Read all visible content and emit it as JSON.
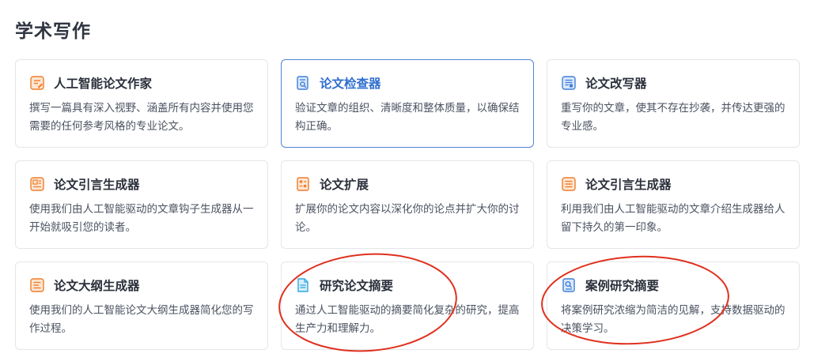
{
  "section": {
    "title": "学术写作"
  },
  "cards": [
    {
      "title": "人工智能论文作家",
      "desc": "撰写一篇具有深入视野、涵盖所有内容并使用您需要的任何参考风格的专业论文。",
      "icon": "pen-on-paper-icon",
      "color": "#f07d2a"
    },
    {
      "title": "论文检查器",
      "desc": "验证文章的组织、清晰度和整体质量，以确保结构正确。",
      "icon": "document-search-icon",
      "color": "#3f7fd8"
    },
    {
      "title": "论文改写器",
      "desc": "重写你的文章，使其不存在抄袭，并传达更强的专业感。",
      "icon": "document-rewrite-icon",
      "color": "#3f7fd8"
    },
    {
      "title": "论文引言生成器",
      "desc": "使用我们由人工智能驱动的文章钩子生成器从一开始就吸引您的读者。",
      "icon": "image-document-icon",
      "color": "#f07d2a"
    },
    {
      "title": "论文扩展",
      "desc": "扩展你的论文内容以深化你的论点并扩大你的讨论。",
      "icon": "document-expand-icon",
      "color": "#f07d2a"
    },
    {
      "title": "论文引言生成器",
      "desc": "利用我们由人工智能驱动的文章介绍生成器给人留下持久的第一印象。",
      "icon": "text-document-icon",
      "color": "#f07d2a"
    },
    {
      "title": "论文大纲生成器",
      "desc": "使用我们的人工智能论文大纲生成器简化您的写作过程。",
      "icon": "outline-document-icon",
      "color": "#f07d2a"
    },
    {
      "title": "研究论文摘要",
      "desc": "通过人工智能驱动的摘要简化复杂的研究，提高生产力和理解力。",
      "icon": "research-document-icon",
      "color": "#2fa8e0"
    },
    {
      "title": "案例研究摘要",
      "desc": "将案例研究浓缩为简洁的见解，支持数据驱动的决策学习。",
      "icon": "case-study-icon",
      "color": "#3f7fd8"
    }
  ],
  "active_card_index": 1
}
